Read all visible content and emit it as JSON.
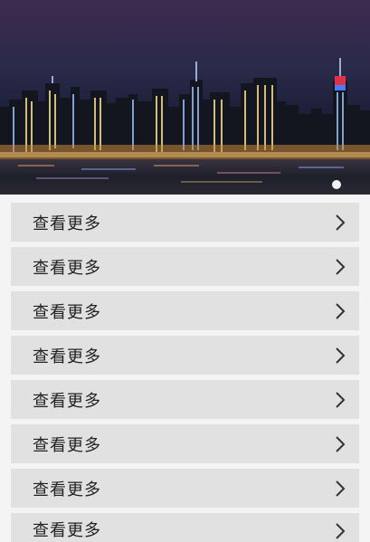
{
  "banner": {
    "slides": 1,
    "active_slide": 1
  },
  "list": {
    "items": [
      {
        "label": "查看更多",
        "icon": "chevron-right-icon"
      },
      {
        "label": "查看更多",
        "icon": "chevron-right-icon"
      },
      {
        "label": "查看更多",
        "icon": "chevron-right-icon"
      },
      {
        "label": "查看更多",
        "icon": "chevron-right-icon"
      },
      {
        "label": "查看更多",
        "icon": "chevron-right-icon"
      },
      {
        "label": "查看更多",
        "icon": "chevron-right-icon"
      },
      {
        "label": "查看更多",
        "icon": "chevron-right-icon"
      },
      {
        "label": "查看更多",
        "icon": "chevron-right-icon"
      }
    ]
  },
  "colors": {
    "page_background": "#f4f4f4",
    "item_background": "#e1e1e1",
    "text": "#222222"
  }
}
